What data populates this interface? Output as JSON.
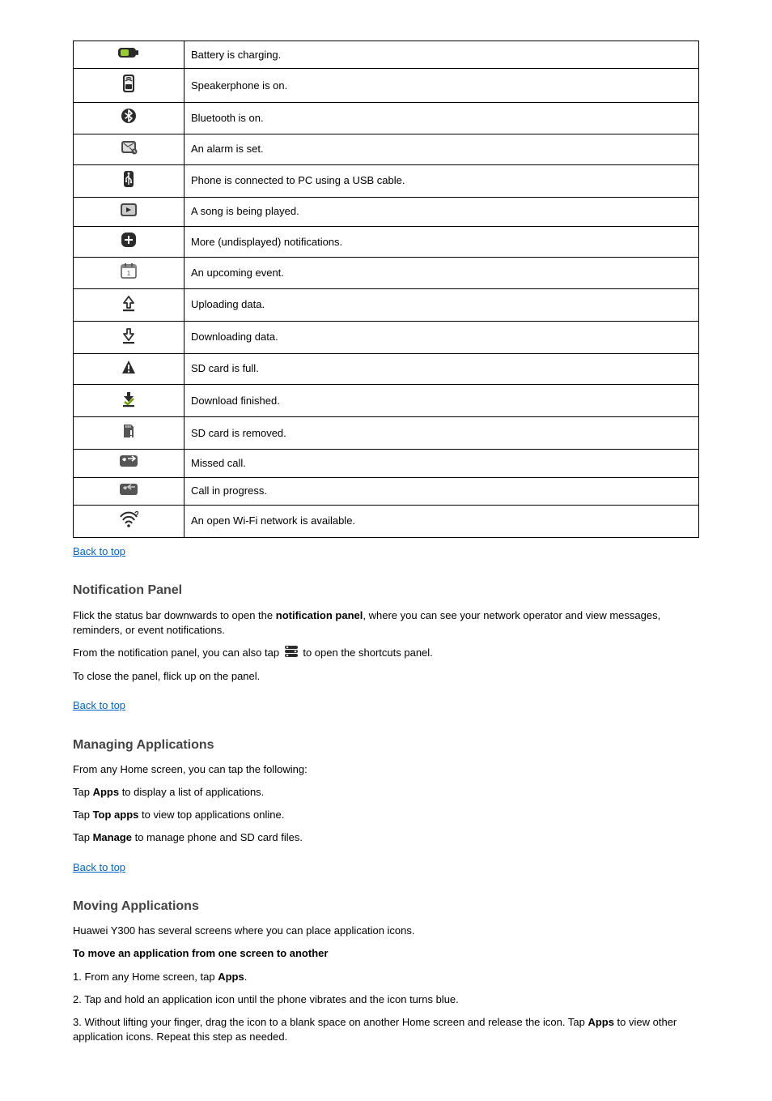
{
  "table": {
    "rows": [
      {
        "icon": "battery-charging-icon",
        "desc": "Battery is charging."
      },
      {
        "icon": "speakerphone-icon",
        "desc": "Speakerphone is on."
      },
      {
        "icon": "bluetooth-icon",
        "desc": "Bluetooth is on."
      },
      {
        "icon": "alarm-icon",
        "desc": "An alarm is set."
      },
      {
        "icon": "usb-icon",
        "desc": "Phone is connected to PC using a USB cable."
      },
      {
        "icon": "music-playing-icon",
        "desc": "A song is being played."
      },
      {
        "icon": "more-notifications-icon",
        "desc": "More (undisplayed) notifications."
      },
      {
        "icon": "calendar-event-icon",
        "desc": "An upcoming event."
      },
      {
        "icon": "upload-icon",
        "desc": "Uploading data."
      },
      {
        "icon": "download-icon",
        "desc": "Downloading data."
      },
      {
        "icon": "sdcard-full-icon",
        "desc": "SD card is full."
      },
      {
        "icon": "download-complete-icon",
        "desc": "Download finished."
      },
      {
        "icon": "sdcard-removed-icon",
        "desc": "SD card is removed."
      },
      {
        "icon": "missed-call-icon",
        "desc": "Missed call."
      },
      {
        "icon": "call-in-progress-icon",
        "desc": "Call in progress."
      },
      {
        "icon": "open-wifi-icon",
        "desc": "An open Wi-Fi network is available."
      }
    ]
  },
  "links": {
    "back_to_top": "Back to top"
  },
  "sections": {
    "notification": {
      "heading": "Notification Panel",
      "p1_a": "Flick the status bar downwards to open the ",
      "p1_b": "notification panel",
      "p1_c": ", where you can see your network operator and view messages, reminders, or event notifications.",
      "p2_a": "From the notification panel, you can also tap ",
      "p2_b": " to open the shortcuts panel.",
      "p3": "To close the panel, flick up on the panel."
    },
    "apps": {
      "heading": "Managing Applications",
      "p1": "From any Home screen, you can tap the following:",
      "b1_a": "Tap ",
      "b1_b": "Apps",
      "b1_c": " to display a list of applications.",
      "b2_a": "Tap  ",
      "b2_b": "Top apps",
      "b2_c": " to view top applications online.",
      "b3_a": "Tap  ",
      "b3_b": "Manage",
      "b3_c": " to manage phone and SD card files."
    },
    "move_apps": {
      "heading": "Moving Applications",
      "p1": "Huawei Y300 has several screens where you can place application icons.",
      "nested_heading": "To move an application from one screen to another",
      "n1_a": "1. From any Home screen, tap ",
      "n1_b": "Apps",
      "n1_c": ".",
      "n2": "2. Tap and hold an application icon until the phone vibrates and the icon turns blue.",
      "n3_a": "3. Without lifting your finger, drag the icon to a blank space on another Home screen and release the icon. Tap ",
      "n3_b": "Apps",
      "n3_c": " to view other application icons. Repeat this step as needed."
    }
  }
}
